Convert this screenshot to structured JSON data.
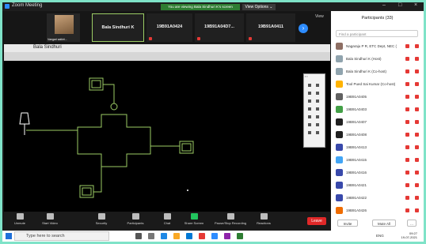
{
  "window": {
    "title": "Zoom Meeting"
  },
  "banner": {
    "text": "You are viewing Bala Sindhuri K's screen",
    "view_options": "View Options ⌄"
  },
  "strip": {
    "self_label": "Vangari saikiri...",
    "tiles": [
      {
        "name": "Bala Sindhuri K"
      },
      {
        "name": "19B91A0424"
      },
      {
        "name": "19B91A04D7..."
      },
      {
        "name": "19B91A0411"
      }
    ],
    "view_label": "View"
  },
  "share": {
    "sharing_label": "Bala Sindhuri"
  },
  "controls": {
    "items": [
      {
        "label": "Unmute"
      },
      {
        "label": "Start Video"
      },
      {
        "label": "Security"
      },
      {
        "label": "Participants",
        "count": "33"
      },
      {
        "label": "Chat"
      },
      {
        "label": "Share Screen"
      },
      {
        "label": "Pause/Stop Recording"
      },
      {
        "label": "Reactions"
      }
    ],
    "end_label": "Leave"
  },
  "panel": {
    "title": "Participants (33)",
    "search_placeholder": "Find a participant",
    "participants": [
      {
        "name": "Nagaraju P R, ETC Dept, NEC (Co-host)",
        "color": "#8d6e63"
      },
      {
        "name": "Bala Sindhuri K (Host)",
        "color": "#90a4ae"
      },
      {
        "name": "Bala Sindhuri K (Co-host)",
        "color": "#90a4ae"
      },
      {
        "name": "Tool Pued Sai Kumar (Co-host)",
        "color": "#ffb300"
      },
      {
        "name": "19B91A0405",
        "color": "#616161"
      },
      {
        "name": "19B91A0403",
        "color": "#43a047"
      },
      {
        "name": "19B91A0407",
        "color": "#212121"
      },
      {
        "name": "19B91A0408",
        "color": "#212121"
      },
      {
        "name": "19B91A0413",
        "color": "#3949ab"
      },
      {
        "name": "19B91A0415",
        "color": "#42a5f5"
      },
      {
        "name": "19B91A0416",
        "color": "#3949ab"
      },
      {
        "name": "19B91A0421",
        "color": "#3949ab"
      },
      {
        "name": "19B91A0422",
        "color": "#3949ab"
      },
      {
        "name": "19B91A0426",
        "color": "#ef6c00"
      }
    ],
    "footer": {
      "invite": "Invite",
      "mute_all": "Mute All",
      "more": "..."
    }
  },
  "taskbar": {
    "search_placeholder": "Type here to search",
    "lang": "ENG",
    "time": "09:27",
    "date": "19-07-2021"
  }
}
